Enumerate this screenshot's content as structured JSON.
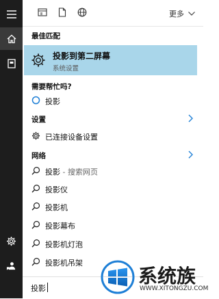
{
  "top_bar": {
    "more_label": "更多"
  },
  "best_match": {
    "heading": "最佳匹配",
    "title": "投影到第二屏幕",
    "subtitle": "系统设置"
  },
  "help": {
    "heading": "需要帮忙吗?",
    "item": "投影"
  },
  "settings": {
    "heading": "设置",
    "item": "已连接设备设置"
  },
  "web": {
    "heading": "网络",
    "items": [
      {
        "label": "投影",
        "suffix": " - 搜索网页"
      },
      {
        "label": "投影仪",
        "suffix": ""
      },
      {
        "label": "投影机",
        "suffix": ""
      },
      {
        "label": "投影幕布",
        "suffix": ""
      },
      {
        "label": "投影机灯泡",
        "suffix": ""
      },
      {
        "label": "投影机吊架",
        "suffix": ""
      }
    ]
  },
  "search": {
    "value": "投影"
  },
  "watermark": {
    "brand": "系统族",
    "url": "WWW.XITONGZU.COM"
  },
  "colors": {
    "rail": "#1d1d1d",
    "highlight": "#a9d6ea",
    "accent": "#1e7fd6"
  }
}
